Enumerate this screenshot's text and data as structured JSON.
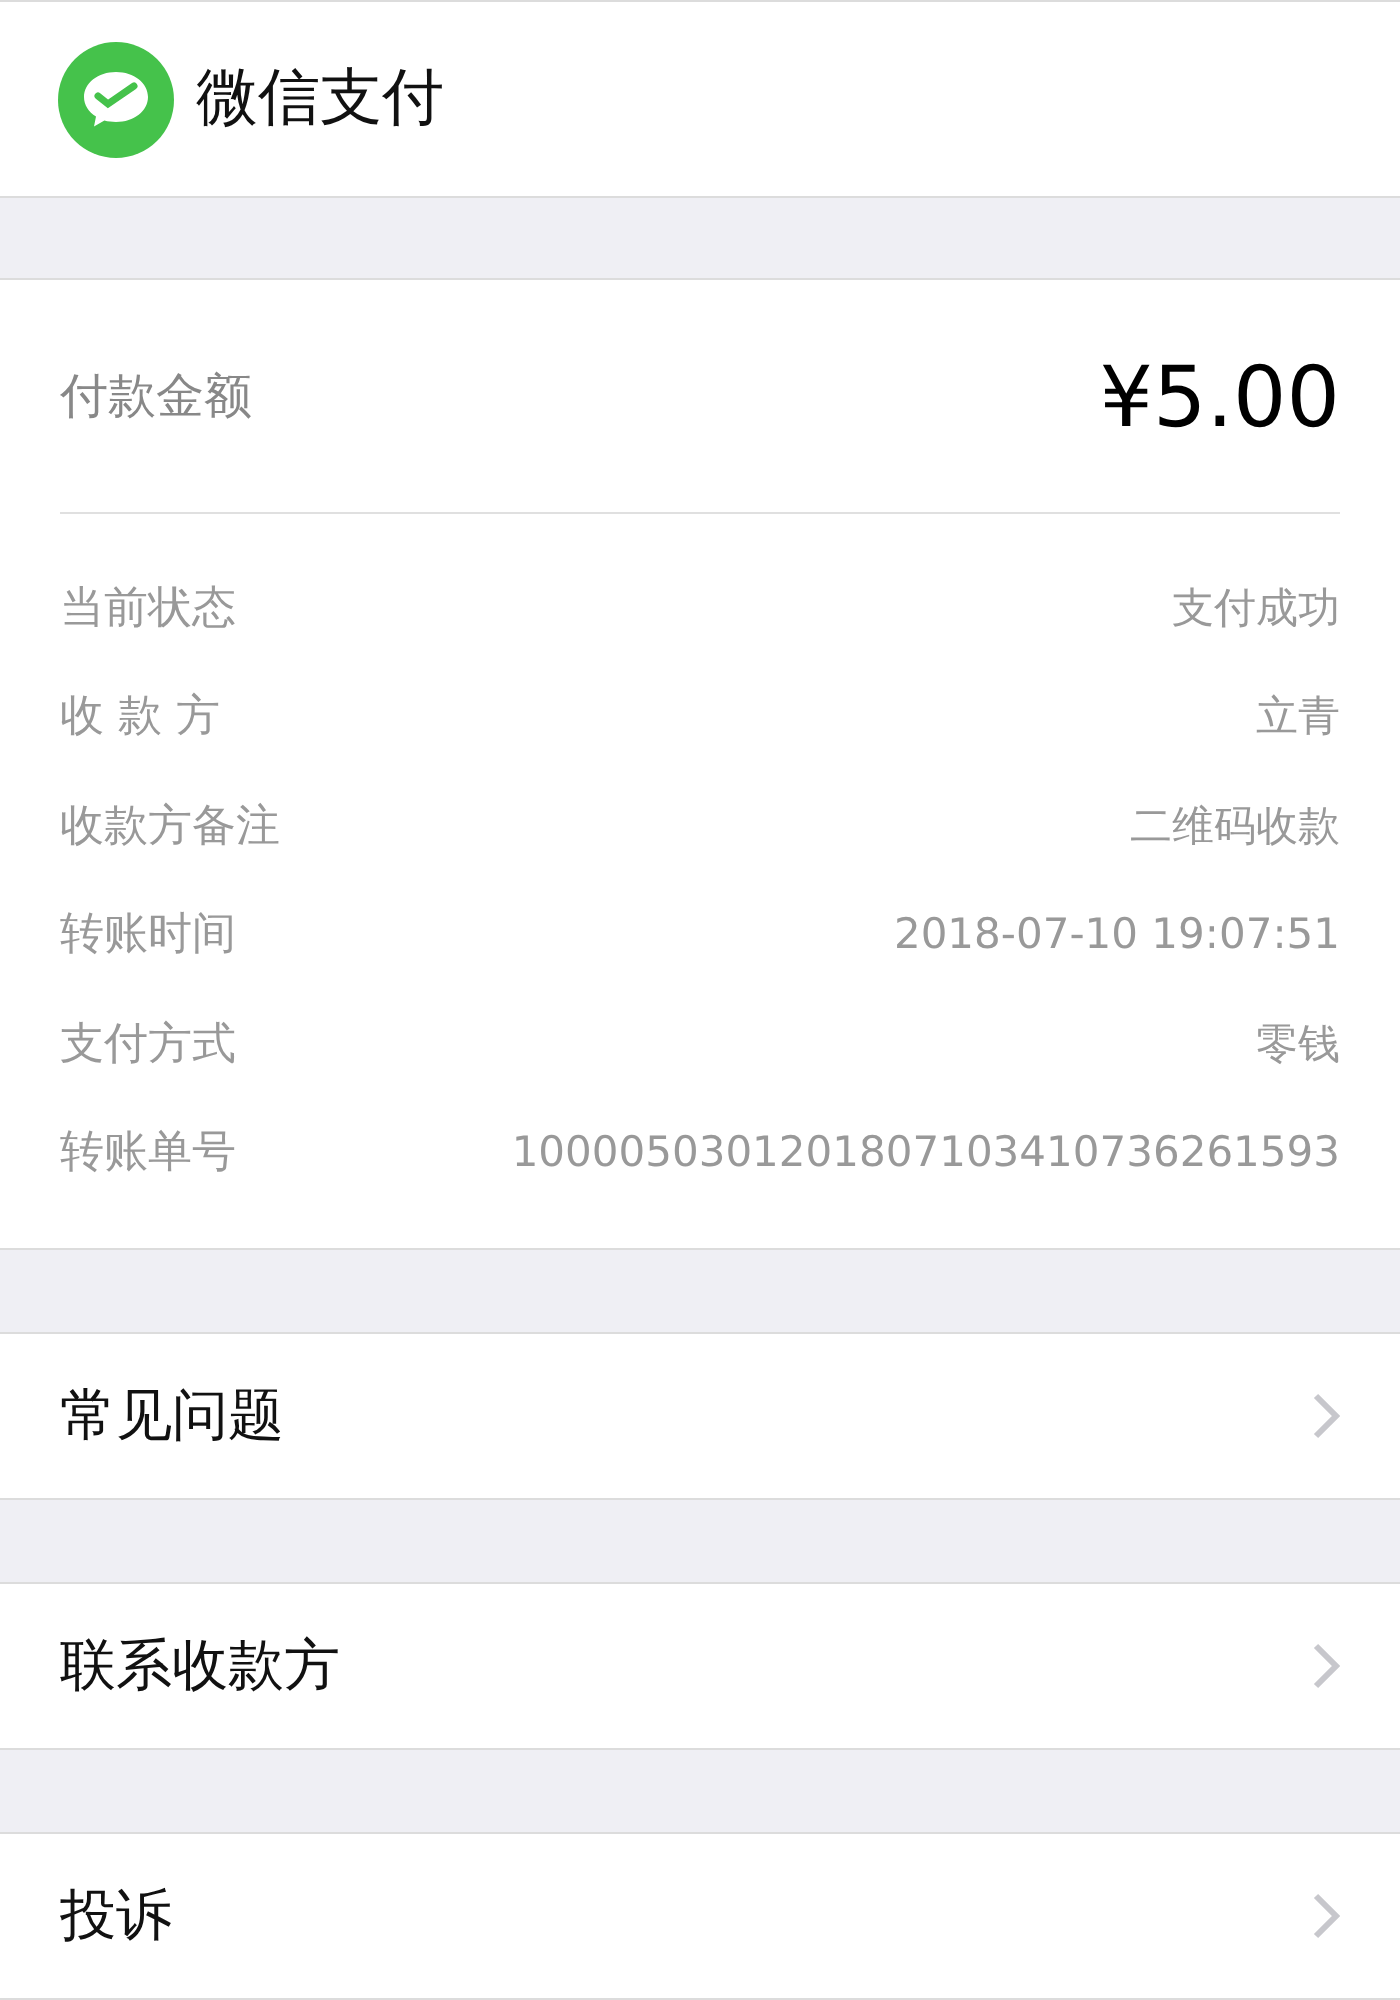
{
  "header": {
    "title": "微信支付"
  },
  "amount": {
    "label": "付款金额",
    "value": "¥5.00"
  },
  "details": [
    {
      "label": "当前状态",
      "value": "支付成功"
    },
    {
      "label": "收 款 方",
      "value": "立青"
    },
    {
      "label": "收款方备注",
      "value": "二维码收款"
    },
    {
      "label": "转账时间",
      "value": "2018-07-10 19:07:51"
    },
    {
      "label": "支付方式",
      "value": "零钱"
    },
    {
      "label": "转账单号",
      "value": "1000050301201807103410736261593"
    }
  ],
  "links": [
    {
      "label": "常见问题"
    },
    {
      "label": "联系收款方"
    },
    {
      "label": "投诉"
    }
  ]
}
